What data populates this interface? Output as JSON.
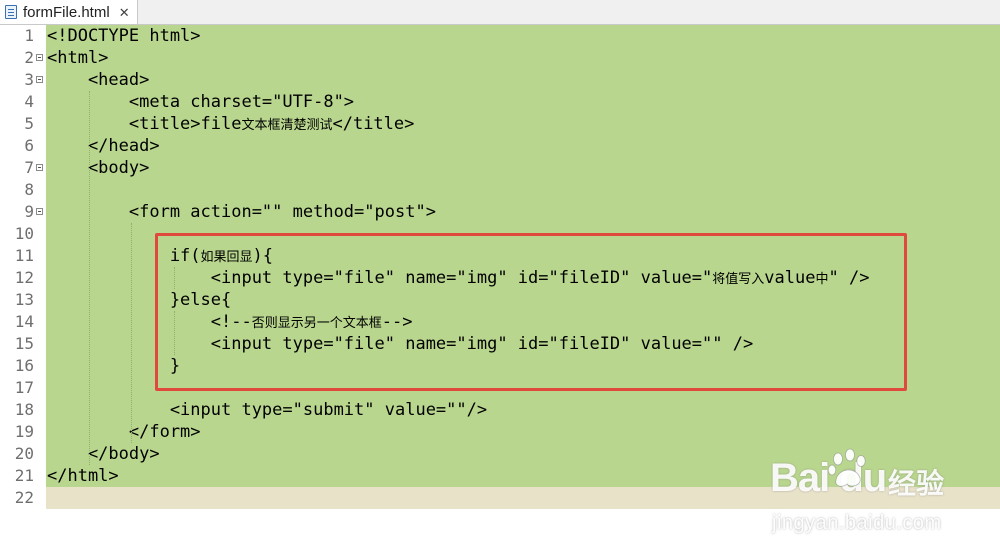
{
  "tab": {
    "title": "formFile.html",
    "close_glyph": "✕",
    "icon": "html-file-icon"
  },
  "editor": {
    "lines": [
      {
        "num": "1",
        "parts": [
          {
            "t": "<!DOCTYPE html>"
          }
        ]
      },
      {
        "num": "2",
        "parts": [
          {
            "t": "<html>"
          }
        ]
      },
      {
        "num": "3",
        "parts": [
          {
            "t": "    <head>"
          }
        ]
      },
      {
        "num": "4",
        "parts": [
          {
            "t": "        <meta charset=\"UTF-8\">"
          }
        ]
      },
      {
        "num": "5",
        "parts": [
          {
            "t": "        <title>file"
          },
          {
            "t": "文本框清楚测试",
            "cjk": true
          },
          {
            "t": "</title>"
          }
        ]
      },
      {
        "num": "6",
        "parts": [
          {
            "t": "    </head>"
          }
        ]
      },
      {
        "num": "7",
        "parts": [
          {
            "t": "    <body>"
          }
        ]
      },
      {
        "num": "8",
        "parts": [
          {
            "t": ""
          }
        ]
      },
      {
        "num": "9",
        "parts": [
          {
            "t": "        <form action=\"\" method=\"post\">"
          }
        ]
      },
      {
        "num": "10",
        "parts": [
          {
            "t": ""
          }
        ]
      },
      {
        "num": "11",
        "parts": [
          {
            "t": "            if("
          },
          {
            "t": "如果回显",
            "cjk": true
          },
          {
            "t": "){"
          }
        ]
      },
      {
        "num": "12",
        "parts": [
          {
            "t": "                <input type=\"file\" name=\"img\" id=\"fileID\" value=\""
          },
          {
            "t": "将值写入",
            "cjk": true
          },
          {
            "t": "value"
          },
          {
            "t": "中",
            "cjk": true
          },
          {
            "t": "\" />"
          }
        ]
      },
      {
        "num": "13",
        "parts": [
          {
            "t": "            }else{"
          }
        ]
      },
      {
        "num": "14",
        "parts": [
          {
            "t": "                <!--"
          },
          {
            "t": "否则显示另一个文本框",
            "cjk": true
          },
          {
            "t": "-->"
          }
        ]
      },
      {
        "num": "15",
        "parts": [
          {
            "t": "                <input type=\"file\" name=\"img\" id=\"fileID\" value=\"\" />"
          }
        ]
      },
      {
        "num": "16",
        "parts": [
          {
            "t": "            }"
          }
        ]
      },
      {
        "num": "17",
        "parts": [
          {
            "t": ""
          }
        ]
      },
      {
        "num": "18",
        "parts": [
          {
            "t": "            <input type=\"submit\" value=\"\"/>"
          }
        ]
      },
      {
        "num": "19",
        "parts": [
          {
            "t": "        </form>"
          }
        ]
      },
      {
        "num": "20",
        "parts": [
          {
            "t": "    </body>"
          }
        ]
      },
      {
        "num": "21",
        "parts": [
          {
            "t": "</html>"
          }
        ]
      },
      {
        "num": "22",
        "parts": [
          {
            "t": ""
          }
        ]
      }
    ],
    "fold_lines": [
      "2",
      "3",
      "7",
      "9"
    ]
  },
  "watermark": {
    "logo": "Bai  du",
    "sub": "经验",
    "url": "jingyan.baidu.com"
  },
  "colors": {
    "selection": "#b9d68e",
    "current_line": "#e8e2c9",
    "highlight_box": "#e04a3d"
  }
}
